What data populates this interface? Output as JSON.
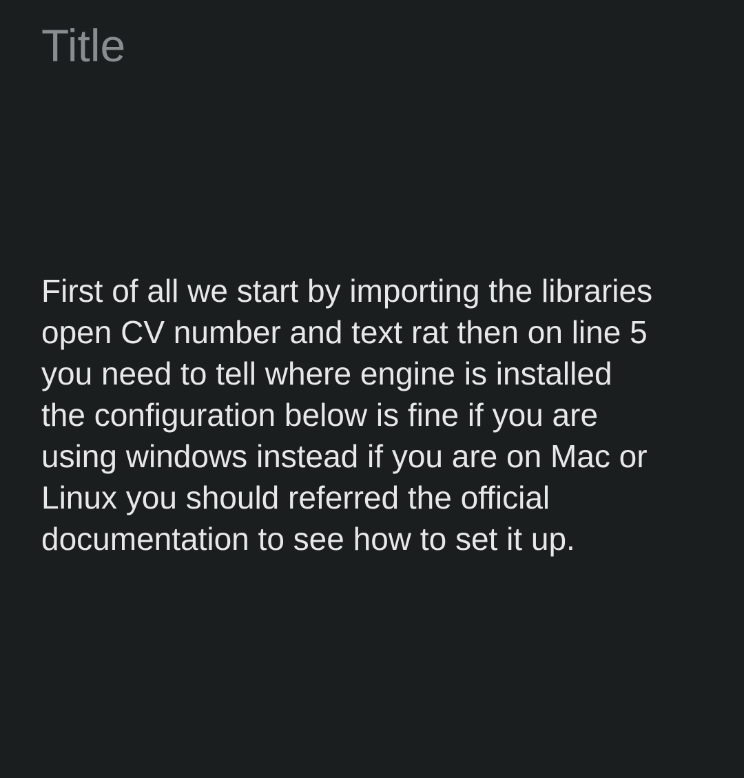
{
  "note": {
    "title": "Title",
    "body_lines": [
      "First of all we start by importing the libraries",
      "open CV number and text rat then on line 5",
      "you need to tell where engine is installed",
      "the configuration below is fine if you are",
      "using windows instead if you are on Mac or",
      "Linux you should referred the official",
      "documentation to see how to set it up."
    ]
  },
  "colors": {
    "background": "#1b1e1f",
    "title_text": "#8a8d8f",
    "body_text": "#e6e8e9"
  }
}
